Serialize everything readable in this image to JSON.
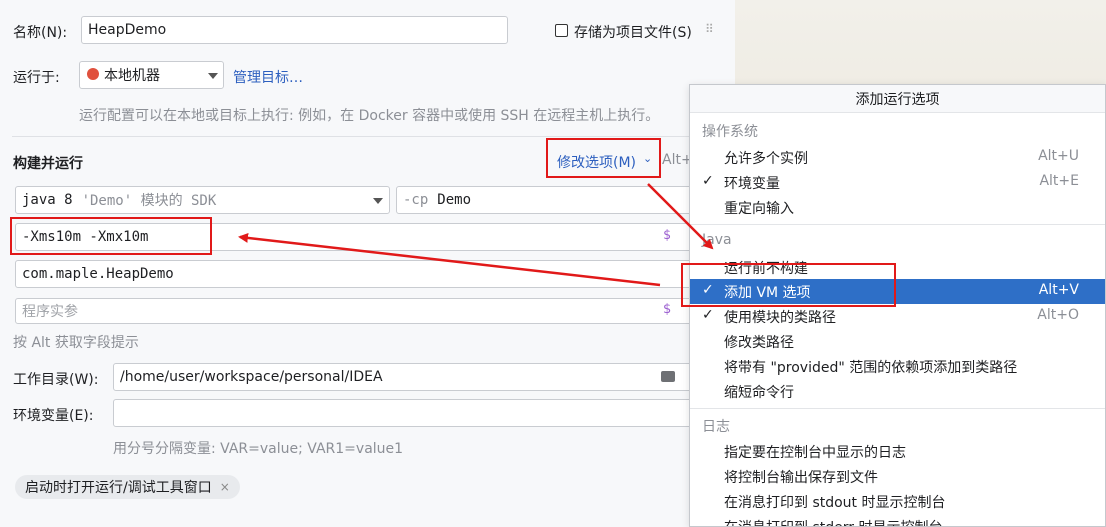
{
  "form": {
    "name_label": "名称(N):",
    "name_value": "HeapDemo",
    "store_label": "存储为项目文件(S)",
    "run_on_label": "运行于:",
    "run_on_value": "本地机器",
    "manage_targets": "管理目标…",
    "run_on_hint": "运行配置可以在本地或目标上执行: 例如，在 Docker 容器中或使用 SSH 在远程主机上执行。",
    "build_run_title": "构建并运行",
    "modify_options": "修改选项(M)",
    "modify_options_shortcut": "Alt+",
    "sdk_bold": "java 8",
    "sdk_rest": "'Demo' 模块的 SDK",
    "cp_prefix": "-cp",
    "cp_value": "Demo",
    "vm_options": "-Xms10m -Xmx10m",
    "main_class": "com.maple.HeapDemo",
    "program_args_placeholder": "程序实参",
    "alt_hint": "按 Alt 获取字段提示",
    "workdir_label": "工作目录(W):",
    "workdir_value": "/home/user/workspace/personal/IDEA",
    "env_label": "环境变量(E):",
    "env_value": "",
    "env_hint": "用分号分隔变量: VAR=value; VAR1=value1",
    "chip_label": "启动时打开运行/调试工具窗口"
  },
  "popup": {
    "title": "添加运行选项",
    "groups": [
      {
        "label": "操作系统",
        "items": [
          {
            "label": "允许多个实例",
            "shortcut": "Alt+U",
            "checked": false
          },
          {
            "label": "环境变量",
            "shortcut": "Alt+E",
            "checked": true
          },
          {
            "label": "重定向输入",
            "shortcut": "",
            "checked": false
          }
        ]
      },
      {
        "label": "Java",
        "items": [
          {
            "label": "运行前不构建",
            "shortcut": "",
            "checked": false
          },
          {
            "label": "添加 VM 选项",
            "shortcut": "Alt+V",
            "checked": true,
            "selected": true
          },
          {
            "label": "使用模块的类路径",
            "shortcut": "Alt+O",
            "checked": true
          },
          {
            "label": "修改类路径",
            "shortcut": "",
            "checked": false
          },
          {
            "label": "将带有 \"provided\" 范围的依赖项添加到类路径",
            "shortcut": "",
            "checked": false
          },
          {
            "label": "缩短命令行",
            "shortcut": "",
            "checked": false
          }
        ]
      },
      {
        "label": "日志",
        "items": [
          {
            "label": "指定要在控制台中显示的日志",
            "shortcut": "",
            "checked": false
          },
          {
            "label": "将控制台输出保存到文件",
            "shortcut": "",
            "checked": false
          },
          {
            "label": "在消息打印到 stdout 时显示控制台",
            "shortcut": "",
            "checked": false
          },
          {
            "label": "在消息打印到 stderr 时显示控制台",
            "shortcut": "",
            "checked": false
          }
        ]
      }
    ]
  },
  "glyphs": {
    "check": "✓",
    "dollar": "$",
    "dots": "⠿",
    "close": "×"
  },
  "colors": {
    "selection": "#2e6fc7",
    "annotation_red": "#e11919",
    "link": "#2d5fbf"
  }
}
